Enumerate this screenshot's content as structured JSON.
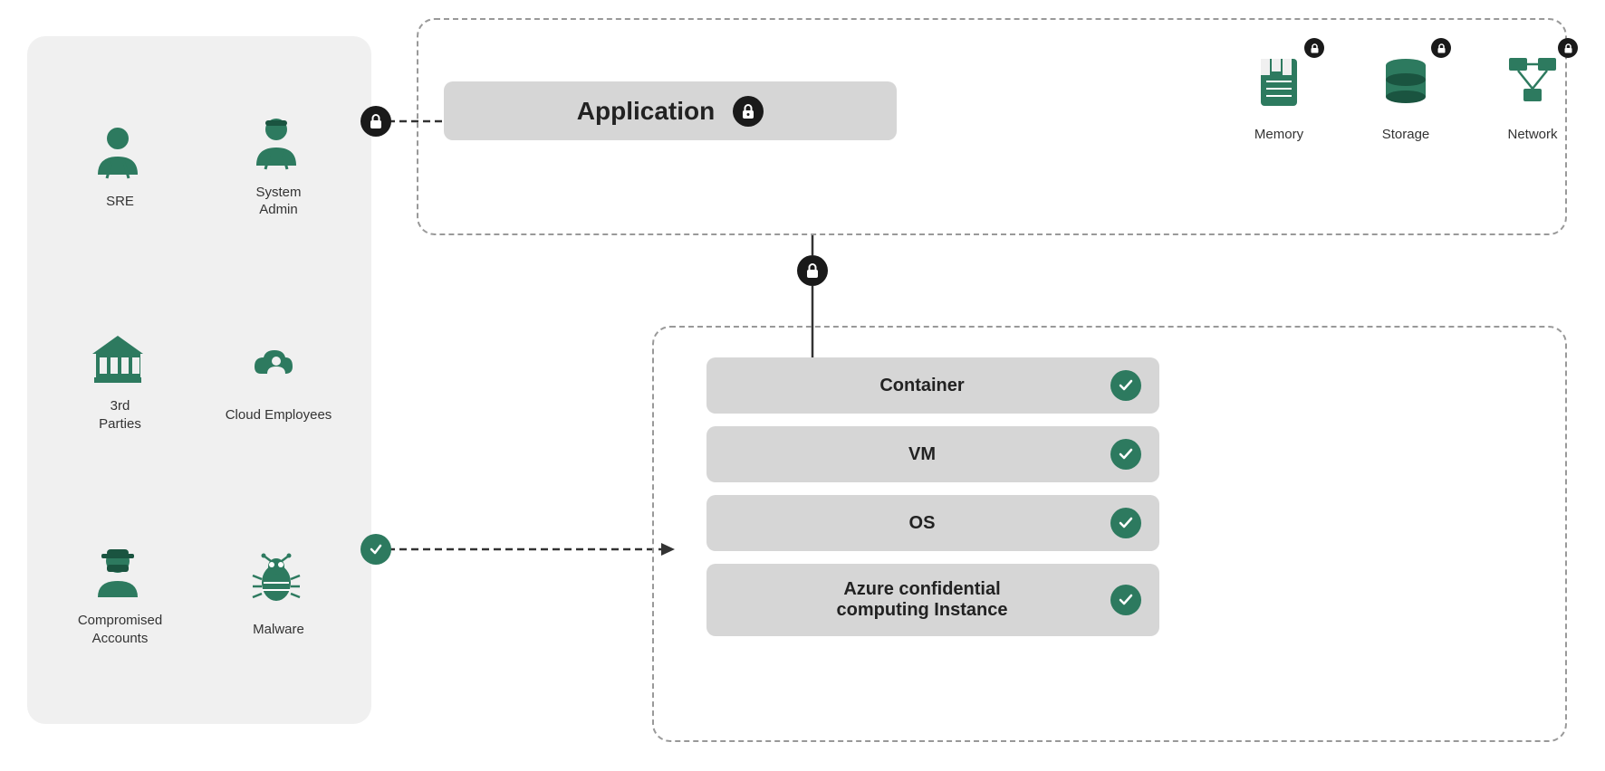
{
  "actors": {
    "items": [
      {
        "id": "sre",
        "label": "SRE",
        "icon": "person"
      },
      {
        "id": "system-admin",
        "label": "System\nAdmin",
        "icon": "person-admin"
      },
      {
        "id": "3rd-parties",
        "label": "3rd\nParties",
        "icon": "building"
      },
      {
        "id": "cloud-employees",
        "label": "Cloud\nEmployees",
        "icon": "cloud-person"
      },
      {
        "id": "compromised-accounts",
        "label": "Compromised\nAccounts",
        "icon": "spy"
      },
      {
        "id": "malware",
        "label": "Malware",
        "icon": "bug"
      }
    ]
  },
  "application": {
    "label": "Application"
  },
  "resources": [
    {
      "id": "memory",
      "label": "Memory"
    },
    {
      "id": "storage",
      "label": "Storage"
    },
    {
      "id": "network",
      "label": "Network"
    }
  ],
  "stack": {
    "items": [
      {
        "id": "container",
        "label": "Container"
      },
      {
        "id": "vm",
        "label": "VM"
      },
      {
        "id": "os",
        "label": "OS"
      },
      {
        "id": "azure",
        "label": "Azure confidential\ncomputing Instance"
      }
    ]
  },
  "icons": {
    "lock": "🔒",
    "check": "✓"
  }
}
